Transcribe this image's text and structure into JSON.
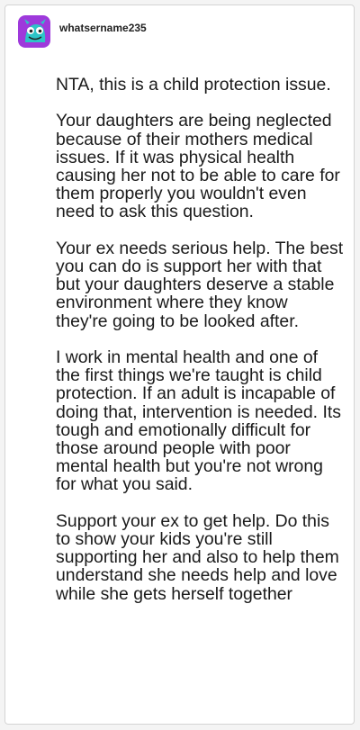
{
  "post": {
    "username": "whatsername235",
    "avatar_icon": "cartoon-creature-avatar-icon",
    "paragraphs": [
      "NTA, this is a child protection issue.",
      "Your daughters are being neglected because of their mothers medical issues. If it was physical health causing her not to be able to care for them properly you wouldn't even need to ask this question.",
      "Your ex needs serious help. The best you can do is support her with that but your daughters deserve a stable environment where they know they're going to be looked after.",
      "I work in mental health and one of the first things we're taught is child protection. If an adult is incapable of doing that, intervention is needed. Its tough and emotionally difficult for those around people with poor mental health but you're not wrong for what you said.",
      "Support your ex to get help. Do this to show your kids you're still supporting her and also to help them understand she needs help and love while she gets herself together"
    ]
  },
  "colors": {
    "background": "#f4f4f4",
    "card": "#ffffff",
    "text": "#1a1a1a",
    "avatar_purple": "#9b3fd6",
    "avatar_teal": "#2ec4c7"
  }
}
